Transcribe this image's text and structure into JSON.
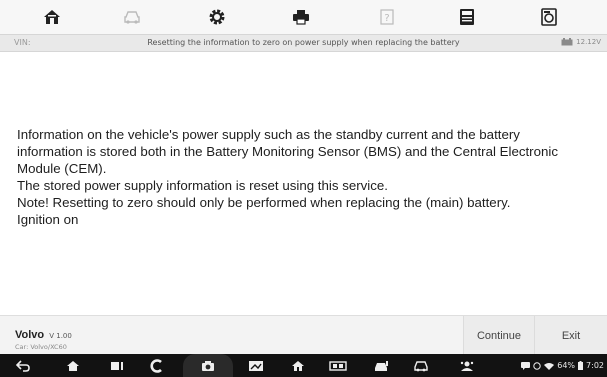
{
  "toolbar": {
    "icons": [
      "home-icon",
      "car-icon",
      "settings-icon",
      "print-icon",
      "help-icon",
      "calculator-icon",
      "save-icon"
    ]
  },
  "vin_bar": {
    "vin_label": "VIN:",
    "title": "Resetting the information to zero on power supply when replacing the battery",
    "voltage": "12.12V"
  },
  "message": {
    "lines": [
      "Information on the vehicle's power supply such as the standby current and the battery",
      "information is stored both in the Battery Monitoring Sensor (BMS) and the Central Electronic",
      "Module (CEM).",
      "The stored power supply information is reset using this service.",
      "Note! Resetting to zero should only be performed when replacing the (main) battery.",
      "Ignition on"
    ]
  },
  "footer": {
    "make": "Volvo",
    "version": "V 1.00",
    "car": "Car: Volvo/XC60",
    "continue_label": "Continue",
    "exit_label": "Exit"
  },
  "status_bar": {
    "battery": "64%",
    "time": "7:02"
  },
  "colors": {
    "toolbar_bg": "#f7f7f7",
    "vin_bar_bg": "#e9e9e9",
    "footer_bg": "#f3f3f3",
    "navbar_bg": "#121212"
  }
}
